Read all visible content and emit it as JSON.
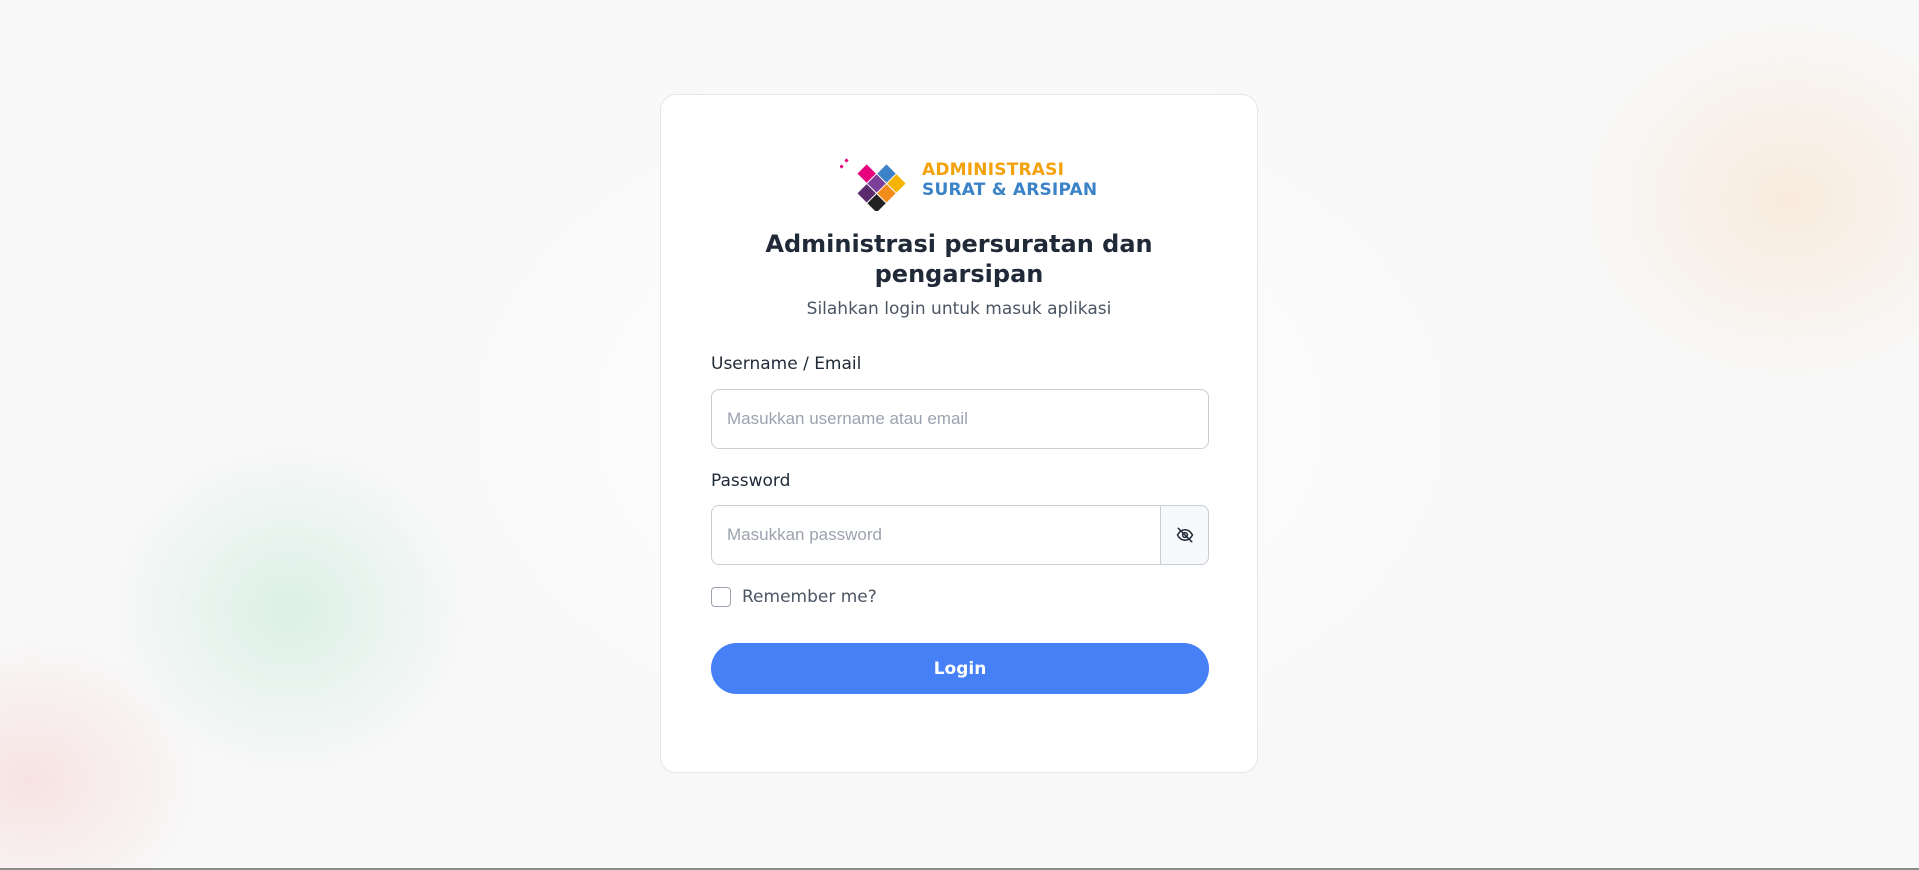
{
  "brand": {
    "line1": "ADMINISTRASI",
    "line2": "SURAT & ARSIPAN",
    "colors": {
      "orange": "#f4a20c",
      "blue": "#3b82c7",
      "magenta": "#e6007e",
      "purple": "#7b3f98",
      "dark": "#222222"
    }
  },
  "heading": {
    "line1": "Administrasi persuratan dan",
    "line2": "pengarsipan"
  },
  "subtitle": "Silahkan login untuk masuk aplikasi",
  "form": {
    "username": {
      "label": "Username / Email",
      "placeholder": "Masukkan username atau email",
      "value": ""
    },
    "password": {
      "label": "Password",
      "placeholder": "Masukkan password",
      "value": "",
      "toggle_icon": "eye-slash-icon"
    },
    "remember": {
      "label": "Remember me?",
      "checked": false
    },
    "submit_label": "Login"
  },
  "colors": {
    "primary": "#4580f7",
    "text": "#1f2937",
    "muted": "#4b5563"
  }
}
